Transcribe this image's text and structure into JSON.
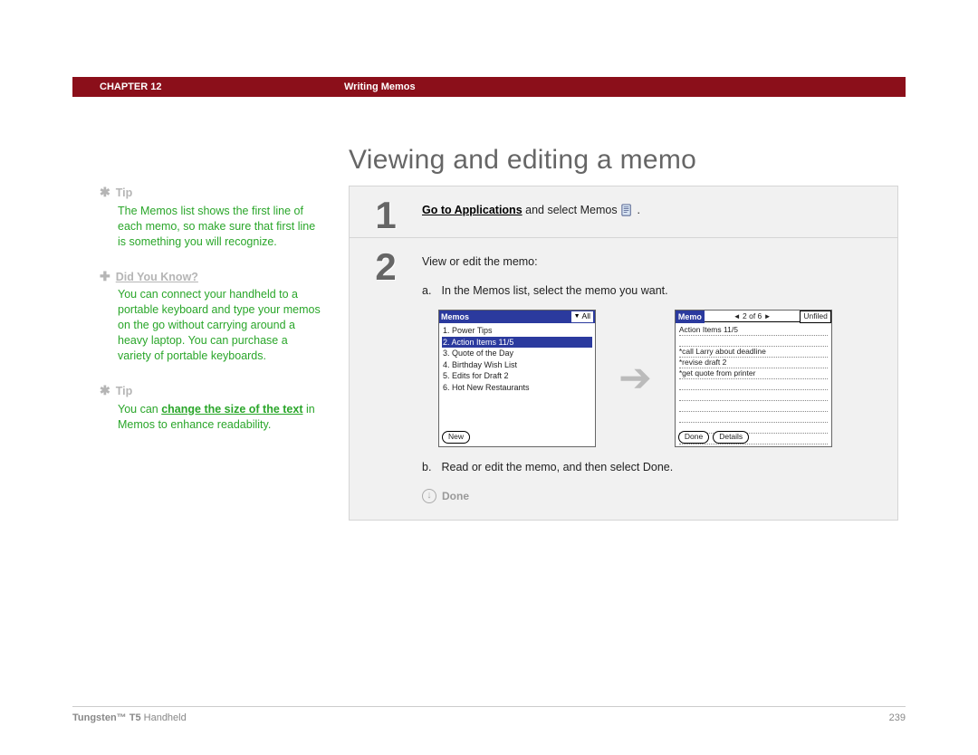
{
  "header": {
    "chapter": "CHAPTER 12",
    "section": "Writing Memos"
  },
  "title": "Viewing and editing a memo",
  "sidebar": {
    "blocks": [
      {
        "type": "tip",
        "heading": "Tip",
        "text": "The Memos list shows the first line of each memo, so make sure that first line is something you will recognize."
      },
      {
        "type": "didyouknow",
        "heading": "Did You Know?",
        "text": "You can connect your handheld to a portable keyboard and type your memos on the go without carrying around a heavy laptop. You can purchase a variety of portable keyboards."
      },
      {
        "type": "tip",
        "heading": "Tip",
        "prefix": "You can ",
        "link": "change the size of the text",
        "suffix": " in Memos to enhance readability."
      }
    ]
  },
  "steps": {
    "step1": {
      "num": "1",
      "linkText": "Go to Applications",
      "rest": " and select Memos ",
      "trailingDot": "."
    },
    "step2": {
      "num": "2",
      "intro": "View or edit the memo:",
      "subA": {
        "label": "a.",
        "text": "In the Memos list, select the memo you want."
      },
      "subB": {
        "label": "b.",
        "text": "Read or edit the memo, and then select Done."
      },
      "done": "Done"
    }
  },
  "palm": {
    "list": {
      "title": "Memos",
      "filter": "All",
      "items": [
        "1. Power Tips",
        "2. Action Items 11/5",
        "3. Quote of the Day",
        "4. Birthday Wish List",
        "5. Edits for Draft 2",
        "6. Hot New Restaurants"
      ],
      "selectedIndex": 1,
      "newBtn": "New"
    },
    "detail": {
      "title": "Memo",
      "counter": "2 of 6",
      "category": "Unfiled",
      "lines": [
        "Action Items 11/5",
        "",
        "*call Larry about deadline",
        "*revise draft 2",
        "*get quote from printer"
      ],
      "doneBtn": "Done",
      "detailsBtn": "Details"
    }
  },
  "footer": {
    "productBold": "Tungsten™ T5",
    "productRest": " Handheld",
    "pageNum": "239"
  }
}
